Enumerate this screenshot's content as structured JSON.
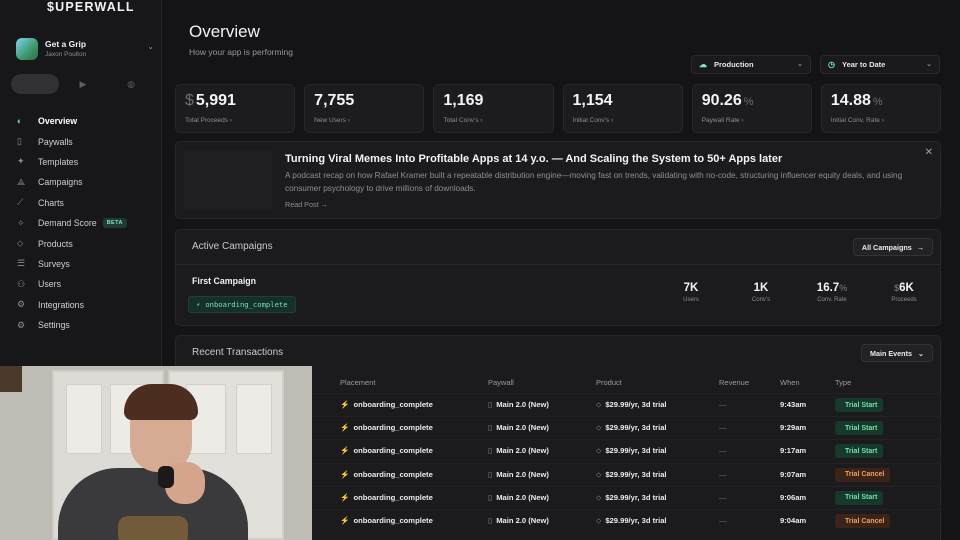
{
  "brand": {
    "logo": "$UPERWALL",
    "accent": "#5fe0b0"
  },
  "app": {
    "name": "Get a Grip",
    "owner": "Jaxon Poulton"
  },
  "platforms": [
    {
      "icon": "apple-icon",
      "glyph": ""
    },
    {
      "icon": "play-store-icon",
      "glyph": "▶"
    },
    {
      "icon": "globe-icon",
      "glyph": "◍"
    }
  ],
  "nav": [
    {
      "label": "Overview",
      "icon": "overview-icon",
      "glyph": "◐",
      "active": true
    },
    {
      "label": "Paywalls",
      "icon": "paywall-icon",
      "glyph": "▯"
    },
    {
      "label": "Templates",
      "icon": "templates-icon",
      "glyph": "✦"
    },
    {
      "label": "Campaigns",
      "icon": "campaigns-icon",
      "glyph": "⟁"
    },
    {
      "label": "Charts",
      "icon": "charts-icon",
      "glyph": "⟋"
    },
    {
      "label": "Demand Score",
      "icon": "sparkle-icon",
      "glyph": "✧",
      "badge": "BETA"
    },
    {
      "label": "Products",
      "icon": "tag-icon",
      "glyph": "⬦"
    },
    {
      "label": "Surveys",
      "icon": "surveys-icon",
      "glyph": "☰"
    },
    {
      "label": "Users",
      "icon": "users-icon",
      "glyph": "⚇"
    },
    {
      "label": "Integrations",
      "icon": "integrations-icon",
      "glyph": "⚙"
    },
    {
      "label": "Settings",
      "icon": "settings-icon",
      "glyph": "⚙"
    }
  ],
  "header": {
    "title": "Overview",
    "subtitle": "How your app is performing"
  },
  "filters": {
    "environment": "Production",
    "range": "Year to Date"
  },
  "stats": [
    {
      "prefix": "$",
      "value": "5,991",
      "suffix": "",
      "label": "Total Proceeds ›"
    },
    {
      "prefix": "",
      "value": "7,755",
      "suffix": "",
      "label": "New Users ›"
    },
    {
      "prefix": "",
      "value": "1,169",
      "suffix": "",
      "label": "Total Conv's ›"
    },
    {
      "prefix": "",
      "value": "1,154",
      "suffix": "",
      "label": "Initial Conv's ›"
    },
    {
      "prefix": "",
      "value": "90.26",
      "suffix": "%",
      "label": "Paywall Rate ›"
    },
    {
      "prefix": "",
      "value": "14.88",
      "suffix": "%",
      "label": "Initial Conv. Rate ›"
    }
  ],
  "blog": {
    "title": "Turning Viral Memes Into Profitable Apps at 14 y.o. — And Scaling the System to 50+ Apps later",
    "description": "A podcast recap on how Rafael Kramer built a repeatable distribution engine—moving fast on trends, validating with no-code, structuring influencer equity deals, and using consumer psychology to drive millions of downloads.",
    "link": "Read Post →",
    "close": "✕"
  },
  "campaigns": {
    "title": "Active Campaigns",
    "all_button": "All Campaigns",
    "name": "First Campaign",
    "placement": "onboarding_complete",
    "stats": [
      {
        "prefix": "",
        "value": "7K",
        "suffix": "",
        "label": "Users"
      },
      {
        "prefix": "",
        "value": "1K",
        "suffix": "",
        "label": "Conv's"
      },
      {
        "prefix": "",
        "value": "16.7",
        "suffix": "%",
        "label": "Conv. Rate"
      },
      {
        "prefix": "$",
        "value": "6K",
        "suffix": "",
        "label": "Proceeds"
      }
    ]
  },
  "transactions": {
    "title": "Recent Transactions",
    "filter": "Main Events",
    "columns": [
      "Placement",
      "Paywall",
      "Product",
      "Revenue",
      "When",
      "Type"
    ],
    "rows": [
      {
        "placement": "onboarding_complete",
        "paywall": "Main 2.0 (New)",
        "product": "$29.99/yr, 3d trial",
        "revenue": "—",
        "when": "9:43am",
        "type": "Trial Start",
        "kind": "start"
      },
      {
        "placement": "onboarding_complete",
        "paywall": "Main 2.0 (New)",
        "product": "$29.99/yr, 3d trial",
        "revenue": "—",
        "when": "9:29am",
        "type": "Trial Start",
        "kind": "start"
      },
      {
        "placement": "onboarding_complete",
        "paywall": "Main 2.0 (New)",
        "product": "$29.99/yr, 3d trial",
        "revenue": "—",
        "when": "9:17am",
        "type": "Trial Start",
        "kind": "start"
      },
      {
        "placement": "onboarding_complete",
        "paywall": "Main 2.0 (New)",
        "product": "$29.99/yr, 3d trial",
        "revenue": "—",
        "when": "9:07am",
        "type": "Trial Cancel",
        "kind": "cancel"
      },
      {
        "placement": "onboarding_complete",
        "paywall": "Main 2.0 (New)",
        "product": "$29.99/yr, 3d trial",
        "revenue": "—",
        "when": "9:06am",
        "type": "Trial Start",
        "kind": "start"
      },
      {
        "placement": "onboarding_complete",
        "paywall": "Main 2.0 (New)",
        "product": "$29.99/yr, 3d trial",
        "revenue": "—",
        "when": "9:04am",
        "type": "Trial Cancel",
        "kind": "cancel"
      }
    ]
  }
}
